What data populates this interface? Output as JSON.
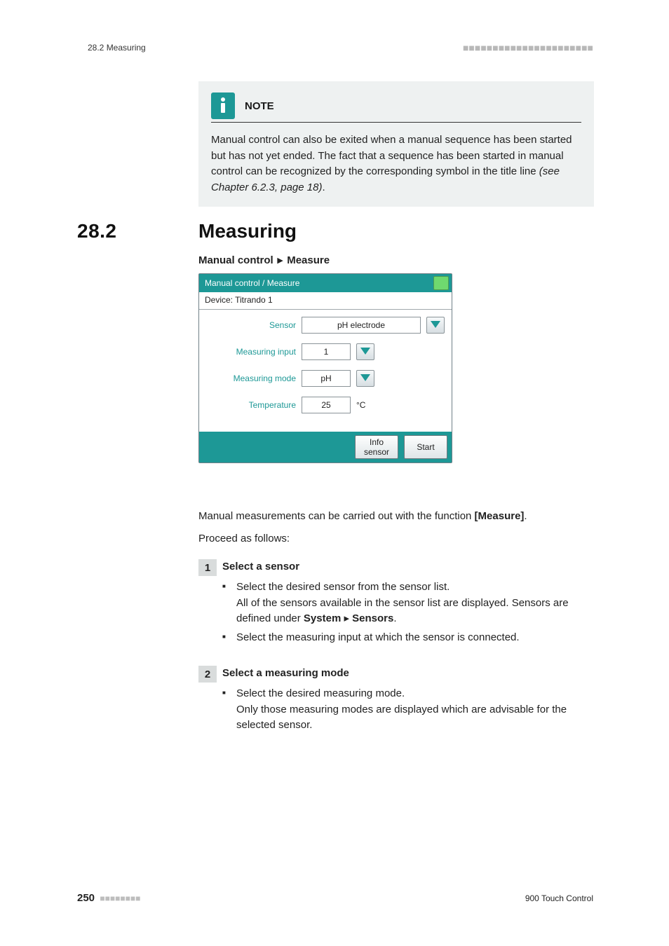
{
  "header": {
    "running_head": "28.2 Measuring",
    "dashes": "■■■■■■■■■■■■■■■■■■■■■■"
  },
  "note": {
    "title": "NOTE",
    "body_pre": "Manual control can also be exited when a manual sequence has been started but has not yet ended. The fact that a sequence has been started in manual control can be recognized by the corresponding symbol in the title line ",
    "body_ital": "(see Chapter 6.2.3, page 18)",
    "body_post": "."
  },
  "section": {
    "number": "28.2",
    "title": "Measuring"
  },
  "breadcrumb": {
    "a": "Manual control",
    "arrow": "▸",
    "b": "Measure"
  },
  "mock": {
    "title": "Manual control / Measure",
    "device": "Device: Titrando 1",
    "rows": {
      "sensor": {
        "label": "Sensor",
        "value": "pH electrode"
      },
      "input": {
        "label": "Measuring input",
        "value": "1"
      },
      "mode": {
        "label": "Measuring mode",
        "value": "pH"
      },
      "temp": {
        "label": "Temperature",
        "value": "25",
        "unit": "°C"
      }
    },
    "footer": {
      "info": "Info\nsensor",
      "start": "Start"
    }
  },
  "paras": {
    "p1_pre": "Manual measurements can be carried out with the function ",
    "p1_bold": "[Measure]",
    "p1_post": ".",
    "p2": "Proceed as follows:"
  },
  "steps": {
    "s1": {
      "num": "1",
      "title": "Select a sensor",
      "li1": "Select the desired sensor from the sensor list.",
      "li1b_pre": "All of the sensors available in the sensor list are displayed. Sensors are defined under ",
      "li1b_bold_a": "System",
      "li1b_arrow": "▸",
      "li1b_bold_b": "Sensors",
      "li1b_post": ".",
      "li2": "Select the measuring input at which the sensor is connected."
    },
    "s2": {
      "num": "2",
      "title": "Select a measuring mode",
      "li1": "Select the desired measuring mode.",
      "li1b": "Only those measuring modes are displayed which are advisable for the selected sensor."
    }
  },
  "footer": {
    "page": "250",
    "dashes": "■■■■■■■■",
    "manual": "900 Touch Control"
  }
}
